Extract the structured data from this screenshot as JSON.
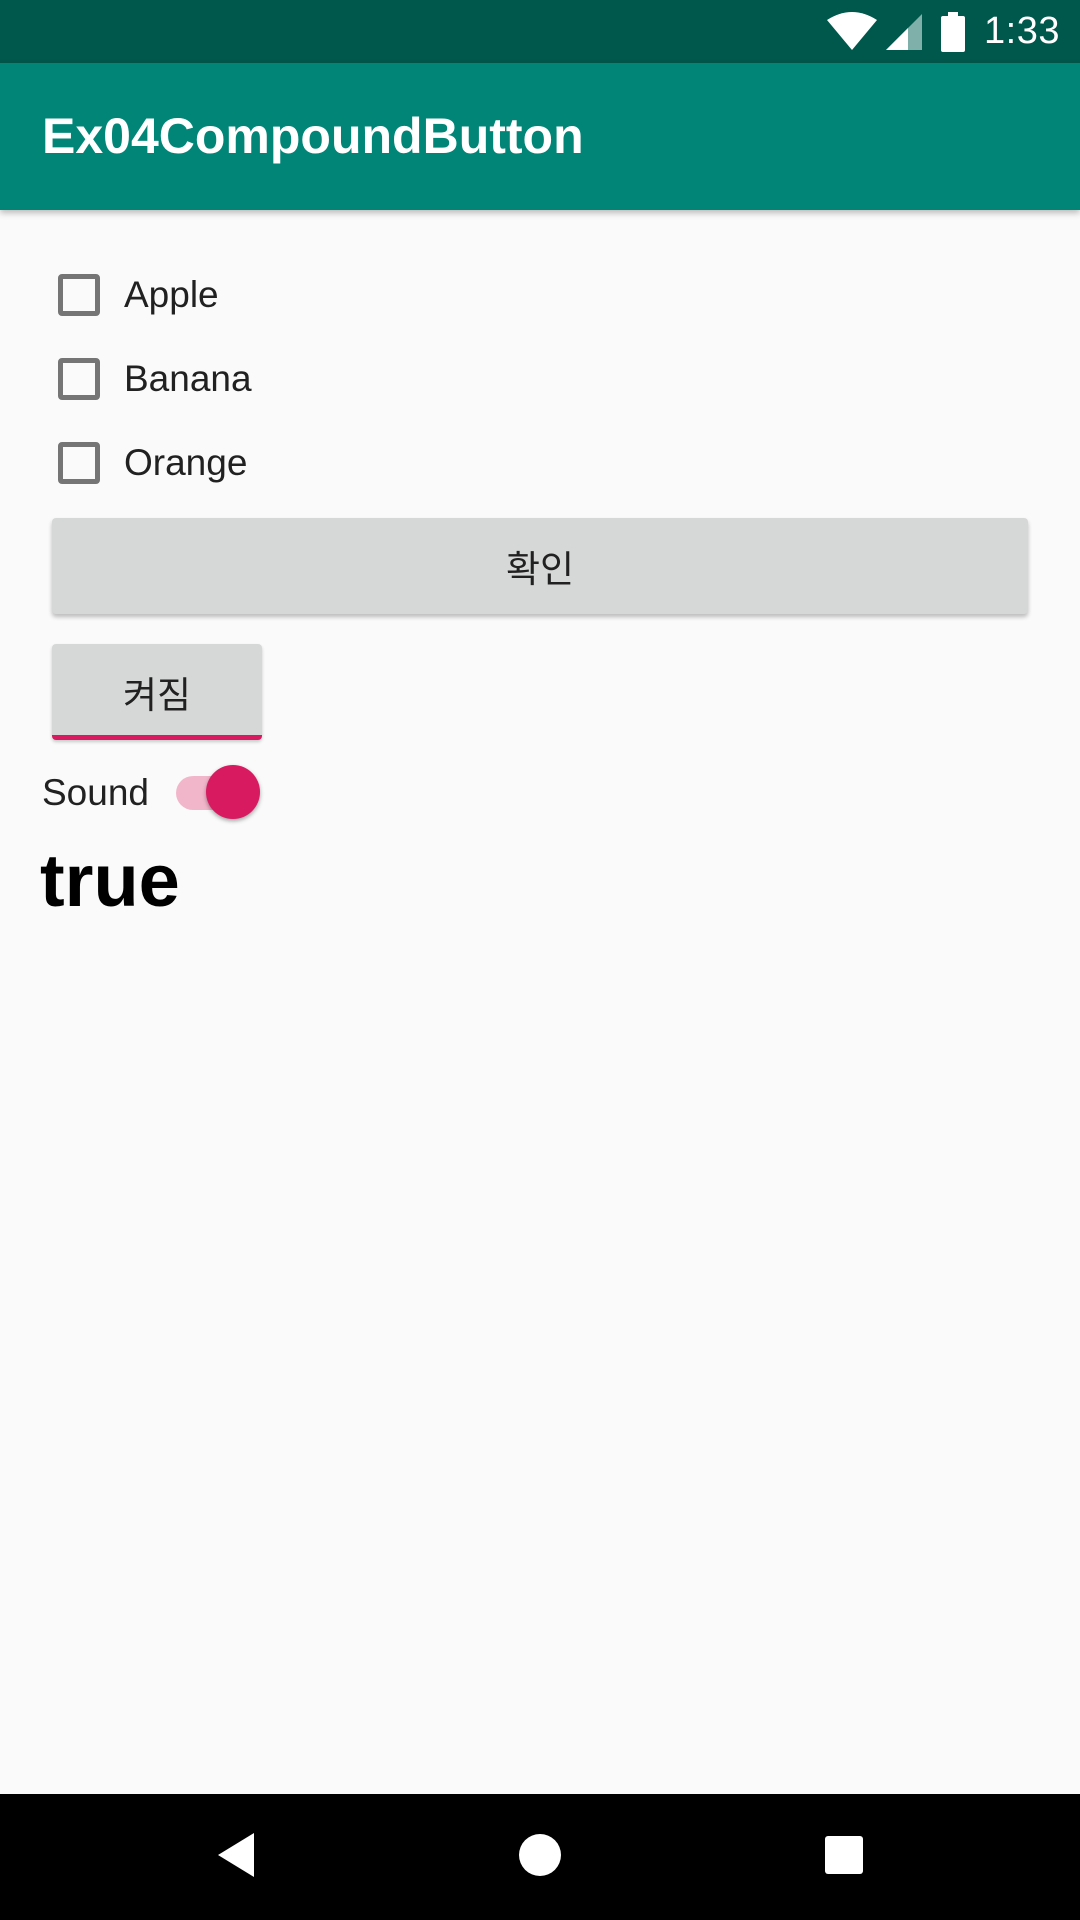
{
  "status_bar": {
    "time": "1:33",
    "icons": [
      "wifi-icon",
      "signal-icon",
      "battery-icon"
    ]
  },
  "app_bar": {
    "title": "Ex04CompoundButton",
    "background": "#008577"
  },
  "checkboxes": [
    {
      "label": "Apple",
      "checked": false
    },
    {
      "label": "Banana",
      "checked": false
    },
    {
      "label": "Orange",
      "checked": false
    }
  ],
  "confirm_button": {
    "label": "확인"
  },
  "toggle_button": {
    "label": "켜짐",
    "checked": true
  },
  "sound_switch": {
    "label": "Sound",
    "checked": true
  },
  "result": {
    "text": "true"
  },
  "accent_color": "#d81b60",
  "nav_bar": {
    "icons": [
      "back-icon",
      "home-icon",
      "recents-icon"
    ]
  }
}
